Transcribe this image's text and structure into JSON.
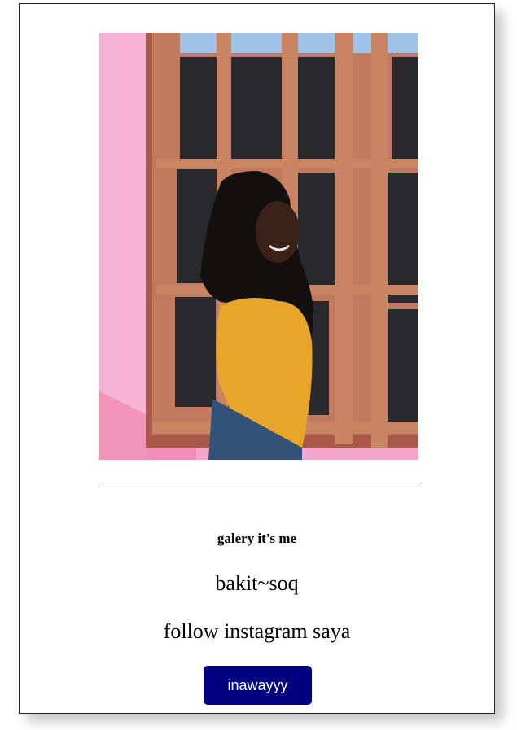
{
  "gallery": {
    "photo_alt": "",
    "title": "galery it's me",
    "name": "bakit~soq",
    "follow_text": "follow instagram saya",
    "button_label": "inawayyy"
  },
  "colors": {
    "button_bg": "#000080",
    "wall_pink": "#f2a2c9",
    "window_frame": "#c0735a",
    "shirt_yellow": "#e8a52a"
  }
}
